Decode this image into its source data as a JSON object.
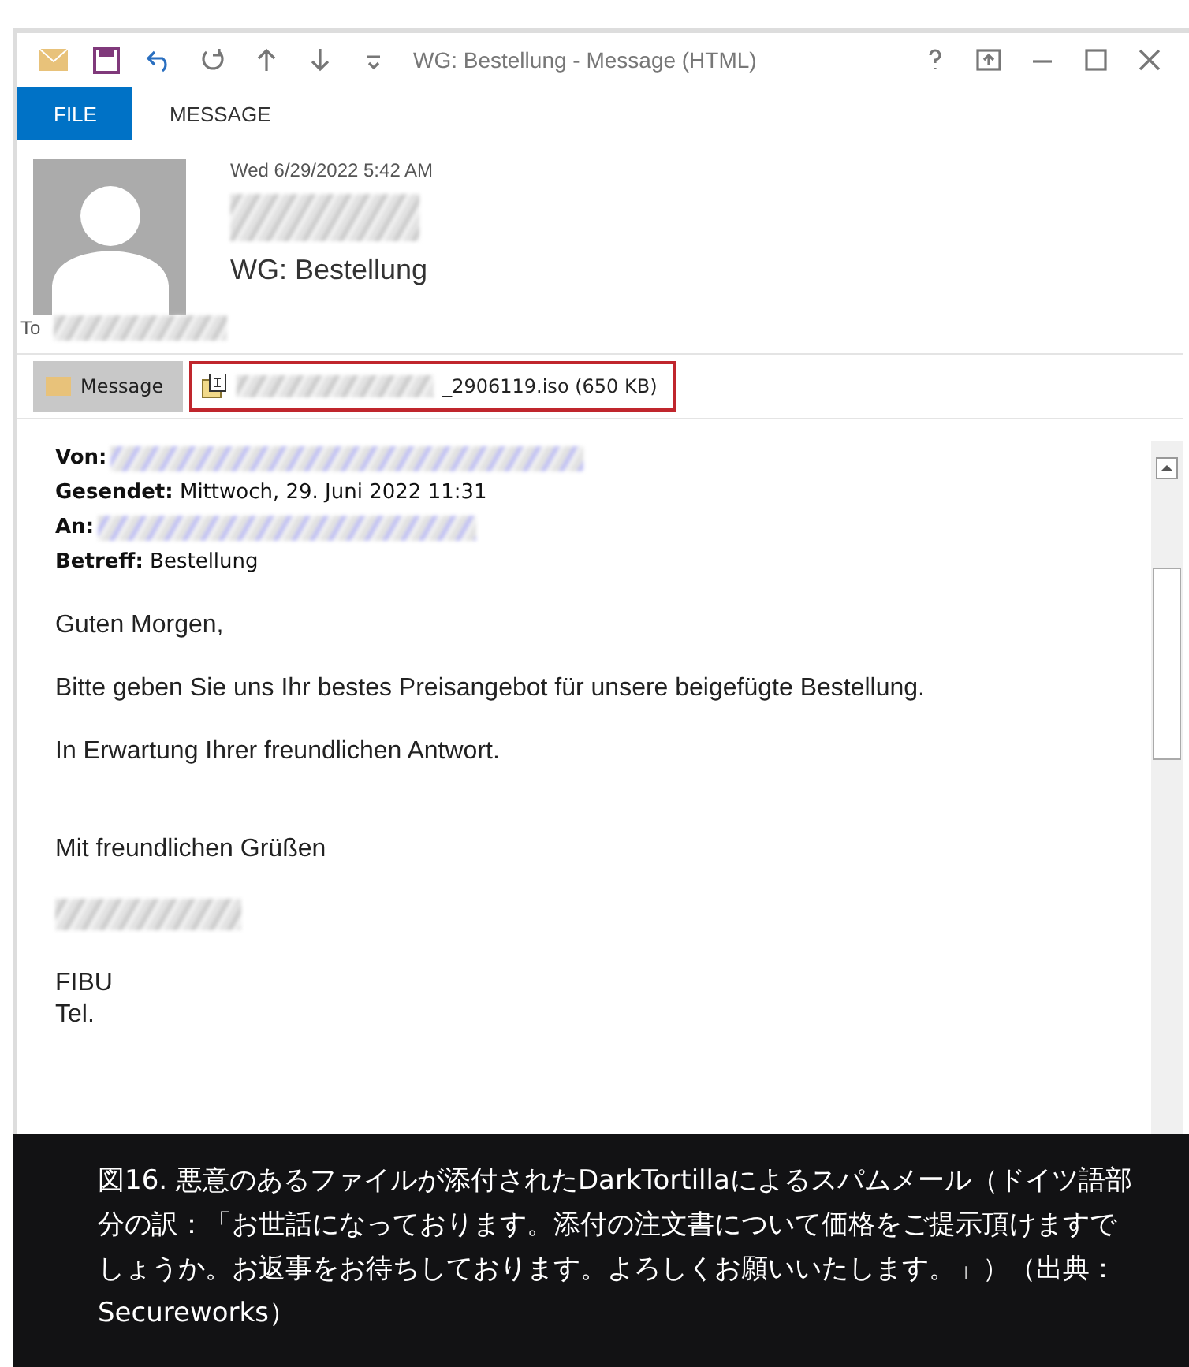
{
  "window": {
    "title": "WG: Bestellung - Message (HTML)"
  },
  "ribbon_tabs": [
    {
      "label": "FILE",
      "selected": true
    },
    {
      "label": "MESSAGE",
      "selected": false
    }
  ],
  "header": {
    "date": "Wed 6/29/2022 5:42 AM",
    "sender_redacted": true,
    "subject": "WG: Bestellung",
    "to_label": "To",
    "to_redacted": true
  },
  "attachments": [
    {
      "kind": "message",
      "label": "Message",
      "selected": true,
      "highlighted": false,
      "name_redacted": false
    },
    {
      "kind": "file",
      "label": "_2906119.iso (650 KB)",
      "selected": false,
      "highlighted": true,
      "name_redacted": true
    }
  ],
  "body": {
    "fields": [
      {
        "text": "**Von:**",
        "redacted": true
      },
      {
        "text": "**Gesendet:** Mittwoch, 29. Juni 2022 11:31",
        "redacted": false
      },
      {
        "text": "**An:**",
        "redacted": true
      },
      {
        "text": "**Betreff:** Bestellung",
        "redacted": false
      }
    ],
    "paragraphs": [
      "Guten Morgen,",
      "Bitte geben Sie uns Ihr bestes Preisangebot für unsere beigefügte Bestellung.",
      "In Erwartung Ihrer freundlichen Antwort.",
      "Mit freundlichen Grüßen"
    ],
    "signature_redacted": true,
    "signature_lines": [
      "FIBU",
      "Tel."
    ]
  },
  "caption": "図16. 悪意のあるファイルが添付されたDarkTortillaによるスパムメール（ドイツ語部分の訳：「お世話になっております。添付の注文書について価格をご提示頂けますでしょうか。お返事をお待ちしております。よろしくお願いいたします。」）（出典：Secureworks）"
}
